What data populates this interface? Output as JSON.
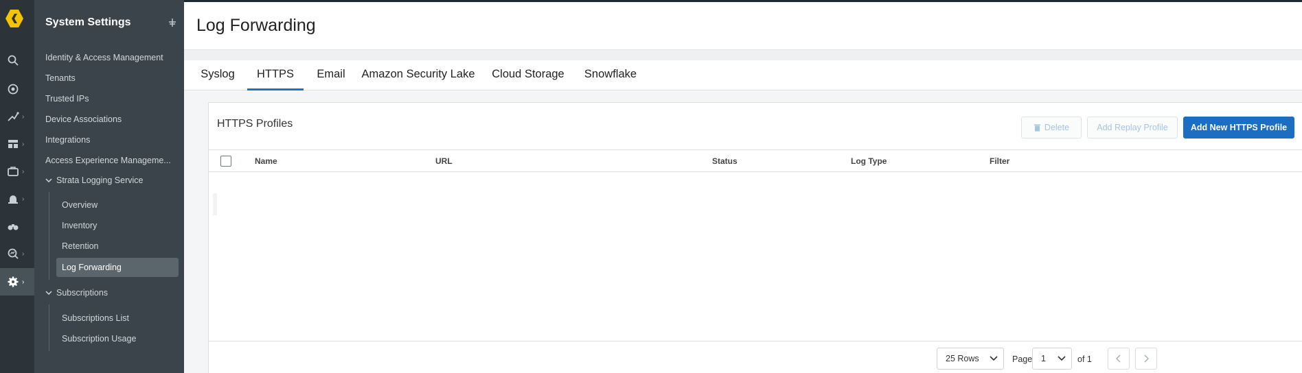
{
  "rail": {
    "icons": [
      "logo-icon",
      "search-icon",
      "target-icon",
      "pipeline-icon",
      "dashboard-icon",
      "briefcase-icon",
      "alarm-icon",
      "binoculars-icon",
      "magnifier-chart-icon",
      "gear-icon"
    ]
  },
  "sidebar": {
    "title": "System Settings",
    "items": [
      "Identity & Access Management",
      "Tenants",
      "Trusted IPs",
      "Device Associations",
      "Integrations",
      "Access Experience Manageme..."
    ],
    "groups": [
      {
        "label": "Strata Logging Service",
        "children": [
          "Overview",
          "Inventory",
          "Retention",
          "Log Forwarding"
        ],
        "active": "Log Forwarding"
      },
      {
        "label": "Subscriptions",
        "children": [
          "Subscriptions List",
          "Subscription Usage"
        ]
      }
    ]
  },
  "main": {
    "title": "Log Forwarding",
    "tabs": [
      "Syslog",
      "HTTPS",
      "Email",
      "Amazon Security Lake",
      "Cloud Storage",
      "Snowflake"
    ],
    "active_tab": "HTTPS",
    "card": {
      "title": "HTTPS Profiles",
      "buttons": {
        "delete": "Delete",
        "add_replay": "Add Replay Profile",
        "add_new": "Add New HTTPS Profile"
      },
      "columns": [
        "Name",
        "URL",
        "Status",
        "Log Type",
        "Filter"
      ],
      "rows": [],
      "footer": {
        "rows_select": "25 Rows",
        "page_label": "Page",
        "page_select": "1",
        "of_label": "of 1"
      }
    }
  },
  "colors": {
    "accent": "#1b6ec2",
    "rail_bg": "#2c3439",
    "sidebar_bg": "#3a444a",
    "logo": "#f5c400"
  }
}
